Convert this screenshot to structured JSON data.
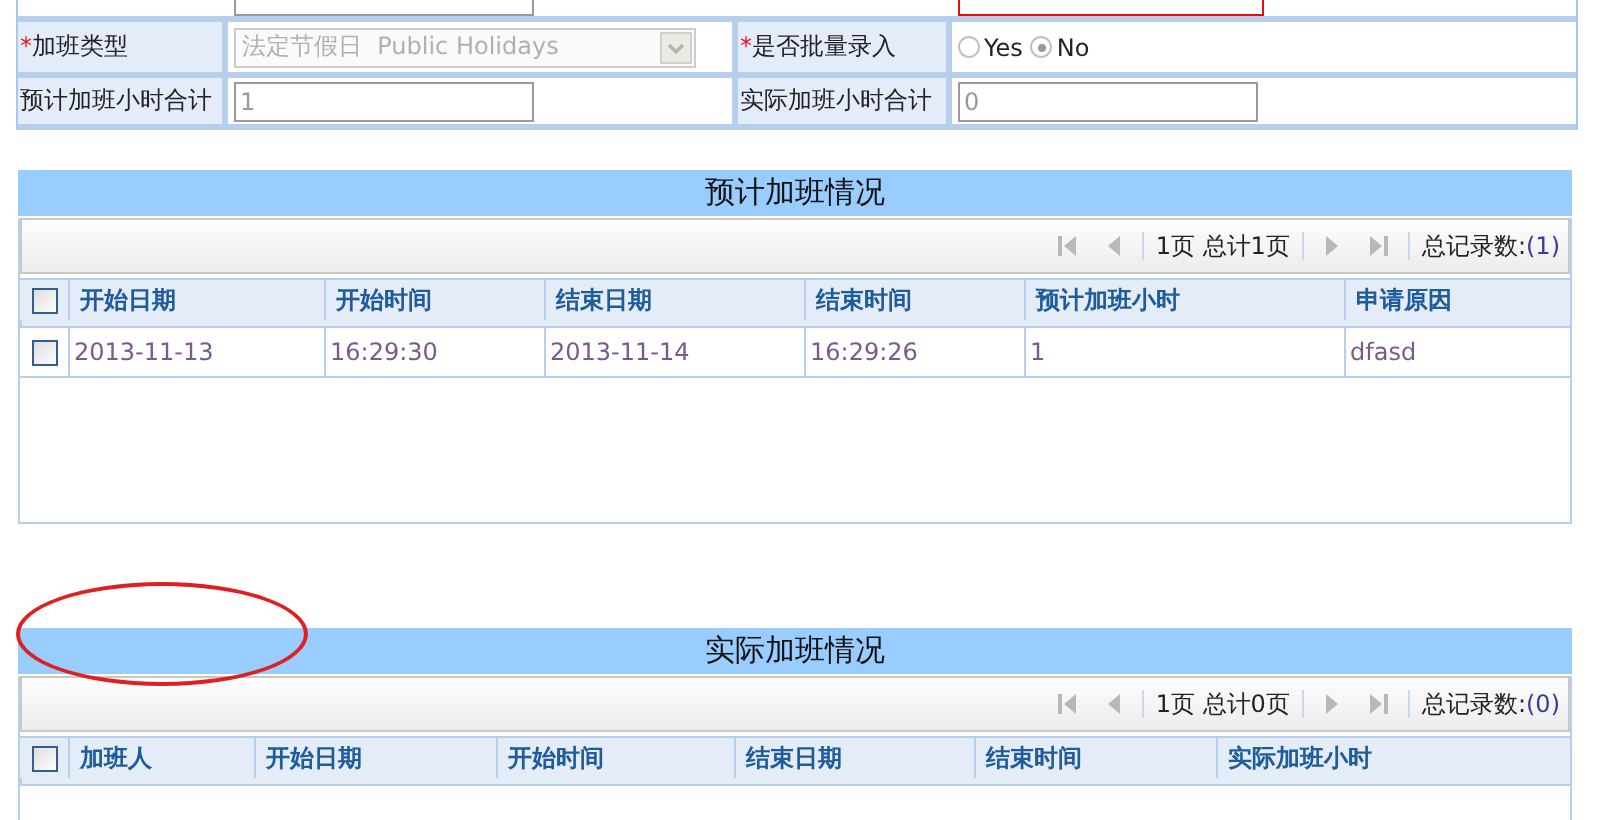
{
  "form": {
    "rows": [
      [
        {
          "field": {
            "kind": "text"
          }
        },
        {
          "field": {
            "kind": "date",
            "highlighted": true
          }
        }
      ],
      [
        {
          "required_mark": "*",
          "label": "加班类型",
          "field": {
            "kind": "select",
            "value": "法定节假日  Public Holidays",
            "disabled": true
          }
        },
        {
          "required_mark": "*",
          "label": "是否批量录入",
          "field": {
            "kind": "radio",
            "options": [
              {
                "label": "Yes",
                "selected": false
              },
              {
                "label": "No",
                "selected": true
              }
            ]
          }
        }
      ],
      [
        {
          "label": "预计加班小时合计",
          "field": {
            "kind": "text",
            "value": "1"
          }
        },
        {
          "label": "实际加班小时合计",
          "field": {
            "kind": "text",
            "value": "0"
          }
        }
      ]
    ]
  },
  "sections": [
    {
      "title": "预计加班情况",
      "pager": {
        "page": "1页 总计1页",
        "total_label": "总记录数:",
        "total": "(1)"
      },
      "all_selected": false,
      "columns": [
        "开始日期",
        "开始时间",
        "结束日期",
        "结束时间",
        "预计加班小时",
        "申请原因"
      ],
      "rows": [
        {
          "selected": false,
          "cells": [
            "2013-11-13",
            "16:29:30",
            "2013-11-14",
            "16:29:26",
            "1",
            "dfasd"
          ]
        }
      ]
    },
    {
      "title": "实际加班情况",
      "pager": {
        "page": "1页 总计0页",
        "total_label": "总记录数:",
        "total": "(0)"
      },
      "all_selected": false,
      "columns": [
        "加班人",
        "开始日期",
        "开始时间",
        "结束日期",
        "结束时间",
        "实际加班小时"
      ]
    }
  ]
}
